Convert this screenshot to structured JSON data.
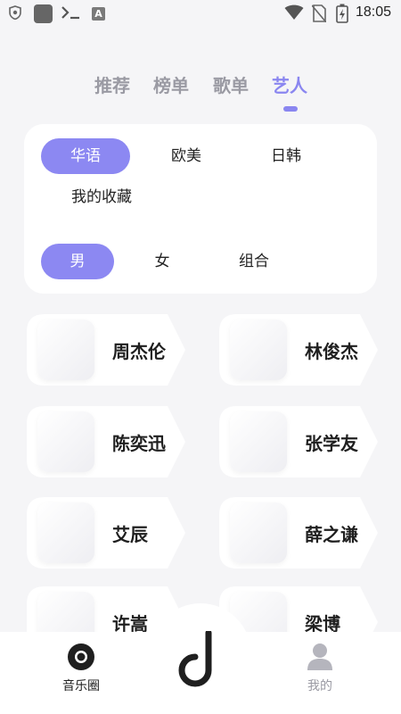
{
  "status_bar": {
    "time": "18:05",
    "notification_letter": "A",
    "icons": [
      "shield-icon",
      "app-square-icon",
      "terminal-icon",
      "a-badge-icon",
      "wifi-icon",
      "no-sim-icon",
      "battery-charging-icon"
    ]
  },
  "tabs": [
    {
      "label": "推荐",
      "active": false
    },
    {
      "label": "榜单",
      "active": false
    },
    {
      "label": "歌单",
      "active": false
    },
    {
      "label": "艺人",
      "active": true
    }
  ],
  "filters": {
    "regions": [
      {
        "label": "华语",
        "active": true
      },
      {
        "label": "欧美",
        "active": false
      },
      {
        "label": "日韩",
        "active": false
      },
      {
        "label": "我的收藏",
        "active": false
      }
    ],
    "genders": [
      {
        "label": "男",
        "active": true
      },
      {
        "label": "女",
        "active": false
      },
      {
        "label": "组合",
        "active": false
      }
    ]
  },
  "artists": [
    {
      "name": "周杰伦"
    },
    {
      "name": "林俊杰"
    },
    {
      "name": "陈奕迅"
    },
    {
      "name": "张学友"
    },
    {
      "name": "艾辰"
    },
    {
      "name": "薛之谦"
    },
    {
      "name": "许嵩"
    },
    {
      "name": "梁博"
    }
  ],
  "bottom_nav": {
    "items": [
      {
        "label": "音乐圈",
        "icon": "vinyl-disc-icon",
        "active": true
      },
      {
        "label": "我的",
        "icon": "user-profile-icon",
        "active": false
      }
    ],
    "center_icon": "music-note-logo-icon"
  },
  "colors": {
    "accent": "#8c88f2",
    "background": "#f5f5f7",
    "wave_gradient_start": "#b9a4f5",
    "wave_gradient_end": "#7f6ce8"
  }
}
